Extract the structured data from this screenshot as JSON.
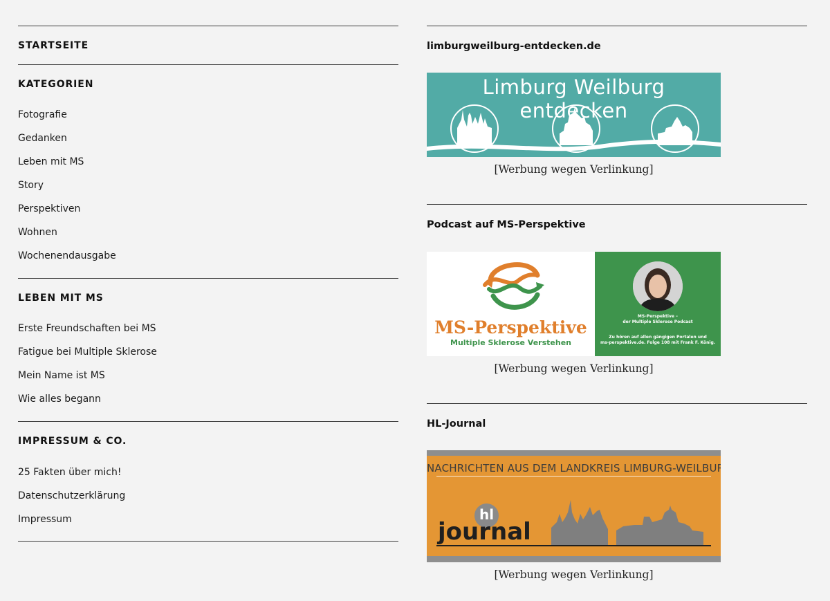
{
  "left": {
    "startseite": "STARTSEITE",
    "kategorien": {
      "heading": "KATEGORIEN",
      "items": [
        "Fotografie",
        "Gedanken",
        "Leben mit MS",
        "Story",
        "Perspektiven",
        "Wohnen",
        "Wochenendausgabe"
      ]
    },
    "leben_mit_ms": {
      "heading": "LEBEN MIT MS",
      "items": [
        "Erste Freundschaften bei MS",
        "Fatigue bei Multiple Sklerose",
        "Mein Name ist MS",
        "Wie alles begann"
      ]
    },
    "impressum": {
      "heading": "IMPRESSUM & CO.",
      "items": [
        "25 Fakten über mich!",
        "Datenschutzerklärung",
        "Impressum"
      ]
    }
  },
  "right": {
    "widgets": [
      {
        "heading": "limburgweilburg-entdecken.de",
        "banner_text": "Limburg Weilburg entdecken",
        "caption": "[Werbung wegen Verlinkung]"
      },
      {
        "heading": "Podcast auf MS-Perspektive",
        "banner_title": "MS-Perspektive",
        "banner_subtitle": "Multiple Sklerose Verstehen",
        "side_line1": "MS-Perspektive –",
        "side_line2": "der Multiple Sklerose Podcast",
        "side_line3": "Zu hören auf allen gängigen Portalen und",
        "side_line4": "ms-perspektive.de. Folge 108 mit Frank F. König.",
        "caption": "[Werbung wegen Verlinkung]"
      },
      {
        "heading": "HL-Journal",
        "banner_title": "NACHRICHTEN AUS DEM LANDKREIS LIMBURG-WEILBURG",
        "logo_hl": "hl",
        "logo_journal": "journal",
        "caption": "[Werbung wegen Verlinkung]"
      }
    ]
  },
  "colors": {
    "background": "#f3f3f3",
    "teal": "#52aba6",
    "ms_orange": "#e07f2c",
    "ms_green": "#3e944c",
    "hl_orange": "#e49634",
    "hl_gray": "#8e8e8e"
  }
}
